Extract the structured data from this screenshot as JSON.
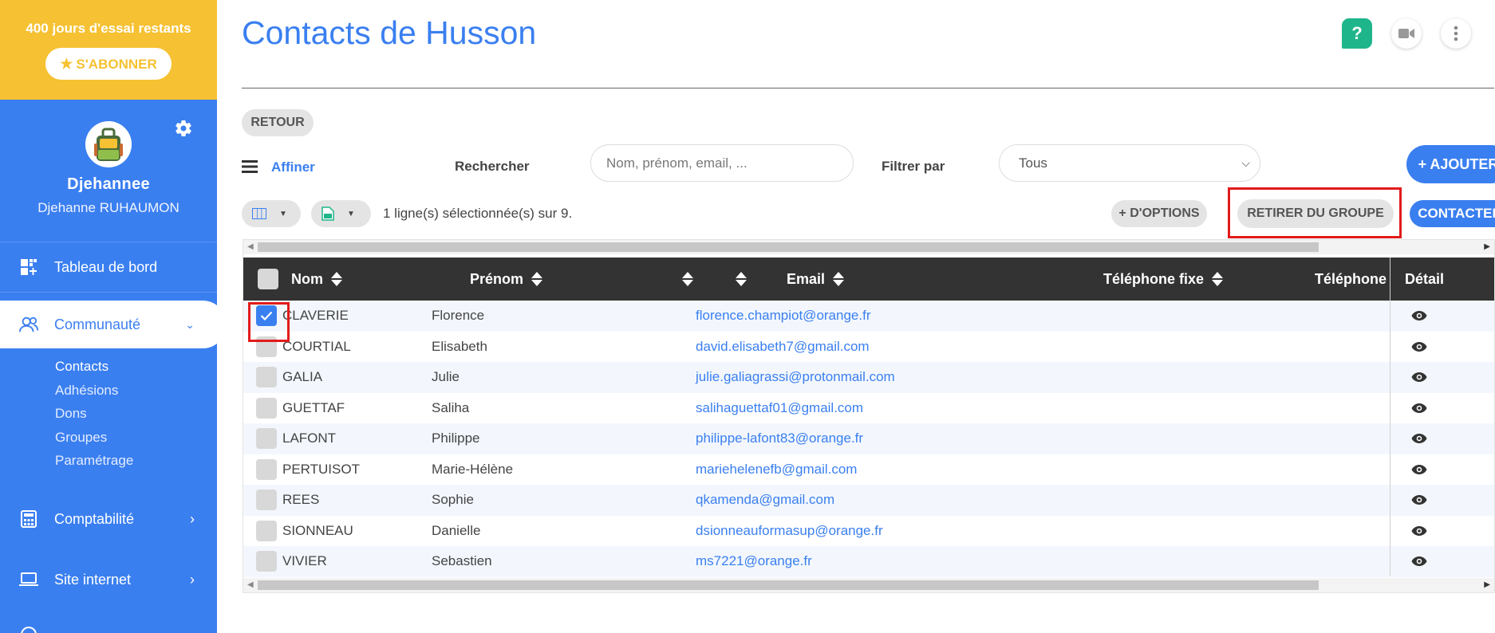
{
  "trial": {
    "text": "400 jours d'essai restants",
    "subscribe_label": "S'ABONNER"
  },
  "user": {
    "name": "Djehannee",
    "fullname": "Djehanne RUHAUMON"
  },
  "nav": {
    "dashboard": "Tableau de bord",
    "community": "Communauté",
    "community_sub": [
      "Contacts",
      "Adhésions",
      "Dons",
      "Groupes",
      "Paramétrage"
    ],
    "accounting": "Comptabilité",
    "website": "Site internet"
  },
  "page": {
    "title": "Contacts de Husson",
    "help_glyph": "?"
  },
  "actions": {
    "back": "RETOUR",
    "refine": "Affiner",
    "search_label": "Rechercher",
    "search_placeholder": "Nom, prénom, email, ...",
    "filter_label": "Filtrer par",
    "filter_value": "Tous",
    "add": "+ AJOUTER",
    "selection_info": "1 ligne(s) sélectionnée(s) sur 9.",
    "more_options": "+ D'OPTIONS",
    "remove_group": "RETIRER DU GROUPE",
    "contact": "CONTACTER"
  },
  "table": {
    "headers": {
      "last_name": "Nom",
      "first_name": "Prénom",
      "email": "Email",
      "phone": "Téléphone fixe",
      "mobile": "Téléphone m",
      "detail": "Détail"
    },
    "rows": [
      {
        "checked": true,
        "last_name": "CLAVERIE",
        "first_name": "Florence",
        "email": "florence.champiot@orange.fr"
      },
      {
        "checked": false,
        "last_name": "COURTIAL",
        "first_name": "Elisabeth",
        "email": "david.elisabeth7@gmail.com"
      },
      {
        "checked": false,
        "last_name": "GALIA",
        "first_name": "Julie",
        "email": "julie.galiagrassi@protonmail.com"
      },
      {
        "checked": false,
        "last_name": "GUETTAF",
        "first_name": "Saliha",
        "email": "salihaguettaf01@gmail.com"
      },
      {
        "checked": false,
        "last_name": "LAFONT",
        "first_name": "Philippe",
        "email": "philippe-lafont83@orange.fr"
      },
      {
        "checked": false,
        "last_name": "PERTUISOT",
        "first_name": "Marie-Hélène",
        "email": "mariehelenefb@gmail.com"
      },
      {
        "checked": false,
        "last_name": "REES",
        "first_name": "Sophie",
        "email": "qkamenda@gmail.com"
      },
      {
        "checked": false,
        "last_name": "SIONNEAU",
        "first_name": "Danielle",
        "email": "dsionneauformasup@orange.fr"
      },
      {
        "checked": false,
        "last_name": "VIVIER",
        "first_name": "Sebastien",
        "email": "ms7221@orange.fr"
      }
    ]
  },
  "colors": {
    "primary": "#3a7ff0",
    "trial_bar": "#f6c132",
    "highlight": "#e21b1b",
    "header_bg": "#333333",
    "help": "#1fb58a"
  }
}
